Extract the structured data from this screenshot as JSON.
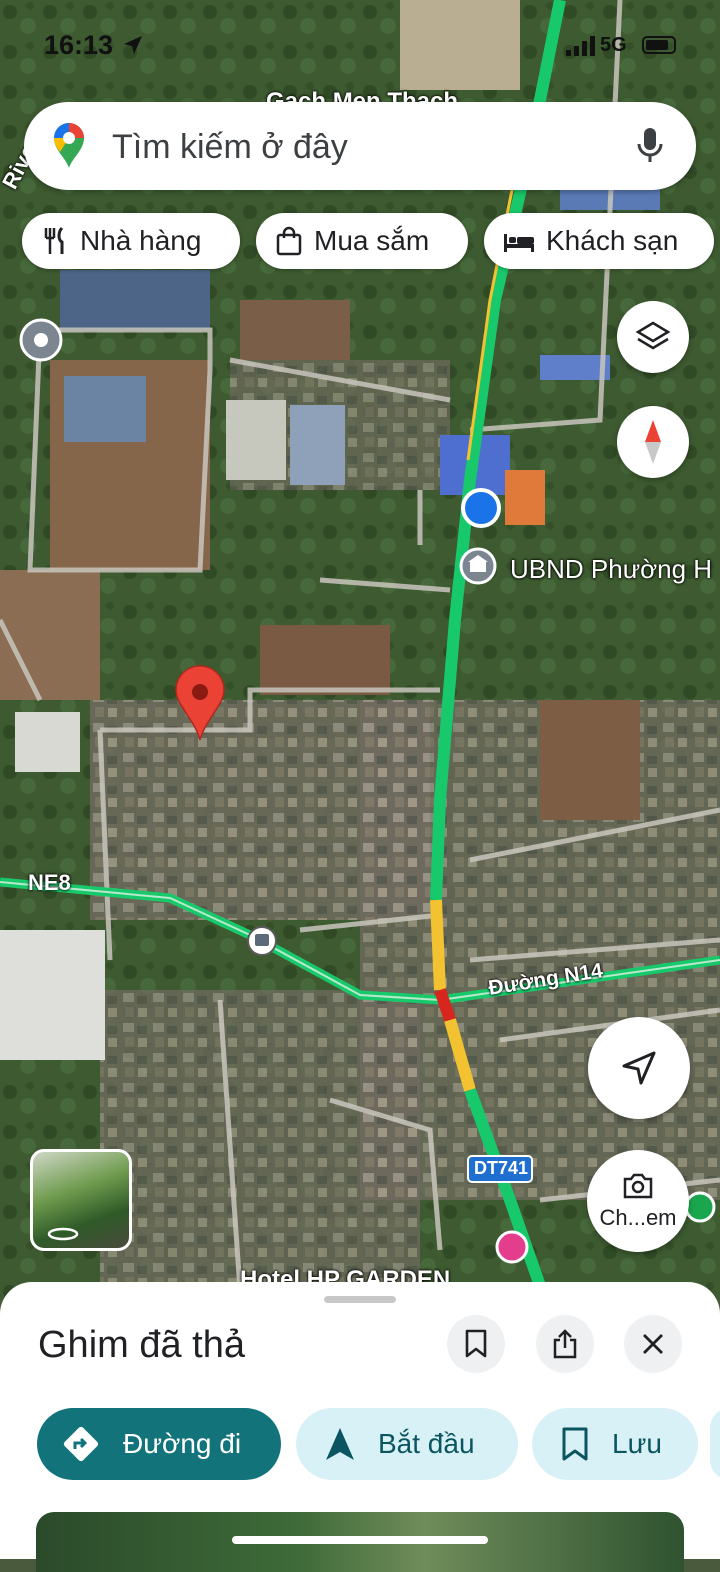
{
  "status_bar": {
    "time": "16:13",
    "network": "5G"
  },
  "search": {
    "placeholder": "Tìm kiếm ở đây"
  },
  "chips": [
    {
      "label": "Nhà hàng",
      "icon": "fork-knife-icon"
    },
    {
      "label": "Mua sắm",
      "icon": "shopping-bag-icon"
    },
    {
      "label": "Khách sạn",
      "icon": "bed-icon"
    }
  ],
  "map": {
    "labels": {
      "top_road": "Gạch Men Thạch",
      "river": "River",
      "poi": "UBND Phường H",
      "ne8": "NE8",
      "n14": "Đường N14",
      "dt741": "DT741",
      "hotel": "Hotel HP GARDEN",
      "street_view": "Ch...em"
    },
    "colors": {
      "traffic_green": "#18c96b",
      "traffic_yellow": "#f2c230",
      "traffic_red": "#d7261e",
      "pin_red": "#ea4335",
      "location_blue": "#1a73e8"
    }
  },
  "sheet": {
    "title": "Ghim đã thả",
    "actions": [
      {
        "label": "Đường đi",
        "icon": "directions-icon"
      },
      {
        "label": "Bắt đầu",
        "icon": "navigation-arrow-icon"
      },
      {
        "label": "Lưu",
        "icon": "bookmark-icon"
      }
    ]
  }
}
